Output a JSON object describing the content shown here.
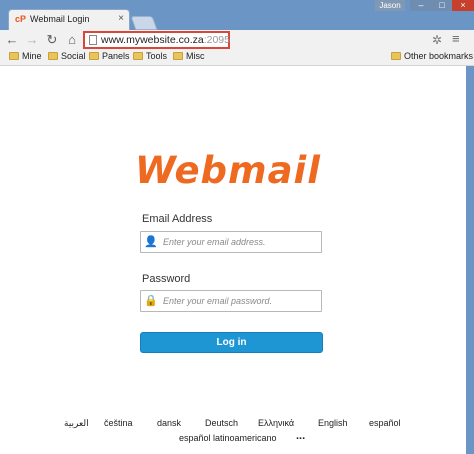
{
  "tab": {
    "title": "Webmail Login",
    "favicon": "cP"
  },
  "window": {
    "user": "Jason"
  },
  "address_bar": {
    "host": "www.mywebsite.co.za",
    "port": ":2095"
  },
  "bookmarks": [
    "Mine",
    "Social",
    "Panels",
    "Tools",
    "Misc"
  ],
  "other_bookmarks": "Other bookmarks",
  "logo": "Webmail",
  "form": {
    "email_label": "Email Address",
    "email_placeholder": "Enter your email address.",
    "password_label": "Password",
    "password_placeholder": "Enter your email password.",
    "login_label": "Log in"
  },
  "languages": [
    "العربية",
    "čeština",
    "dansk",
    "Deutsch",
    "Ελληνικά",
    "English",
    "español",
    "español latinoamericano"
  ],
  "languages_more": "...",
  "colors": {
    "brand": "#ee6a21",
    "button": "#1e96d4",
    "highlight": "#d9473a"
  }
}
